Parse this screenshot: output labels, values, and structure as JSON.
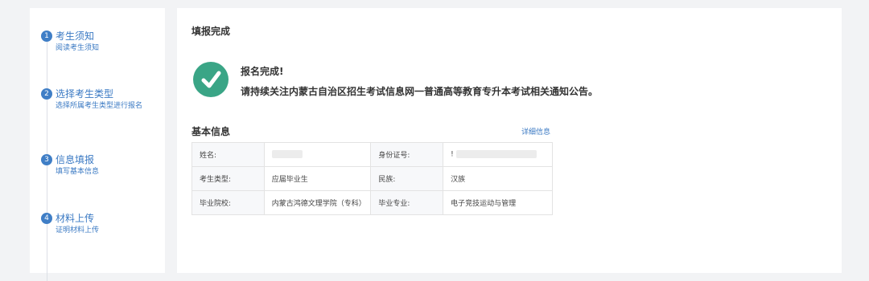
{
  "steps": [
    {
      "num": "1",
      "title": "考生须知",
      "desc": "阅读考生须知"
    },
    {
      "num": "2",
      "title": "选择考生类型",
      "desc": "选择所属考生类型进行报名"
    },
    {
      "num": "3",
      "title": "信息填报",
      "desc": "填写基本信息"
    },
    {
      "num": "4",
      "title": "材料上传",
      "desc": "证明材料上传"
    }
  ],
  "main": {
    "title": "填报完成",
    "success_title": "报名完成!",
    "success_message": "请持续关注内蒙古自治区招生考试信息网一普通高等教育专升本考试相关通知公告。"
  },
  "info": {
    "title": "基本信息",
    "detail_link": "详细信息",
    "rows": [
      {
        "l1": "姓名:",
        "v1": "",
        "l2": "身份证号:",
        "v2": "!"
      },
      {
        "l1": "考生类型:",
        "v1": "应届毕业生",
        "l2": "民族:",
        "v2": "汉族"
      },
      {
        "l1": "毕业院校:",
        "v1": "内蒙古鸿德文理学院（专科）",
        "l2": "毕业专业:",
        "v2": "电子竞技运动与管理"
      }
    ]
  },
  "colors": {
    "accent": "#3a79c3",
    "success": "#3aa586"
  }
}
